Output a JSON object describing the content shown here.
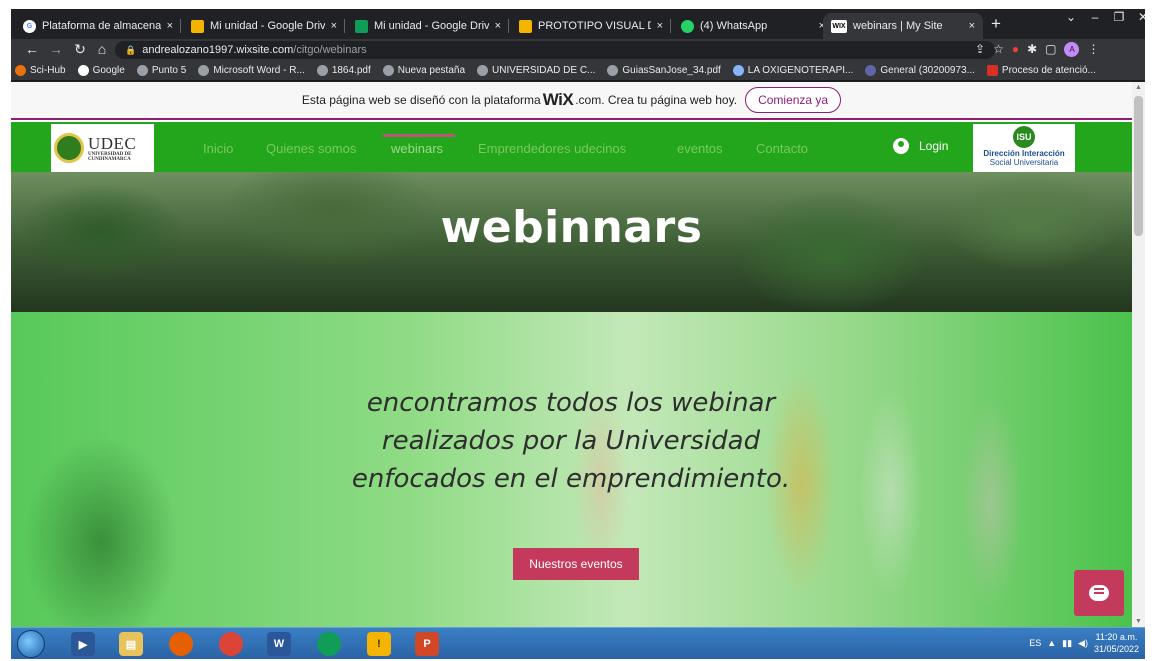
{
  "browser": {
    "tabs": [
      {
        "title": "Plataforma de almacenam",
        "icon": "google-icon",
        "active": false
      },
      {
        "title": "Mi unidad - Google Drive",
        "icon": "drive-icon",
        "active": false
      },
      {
        "title": "Mi unidad - Google Drive",
        "icon": "drive-icon",
        "active": false
      },
      {
        "title": "PROTOTIPO VISUAL DE LA",
        "icon": "drive-icon",
        "active": false
      },
      {
        "title": "(4) WhatsApp",
        "icon": "whatsapp-icon",
        "active": false
      },
      {
        "title": "webinars | My Site",
        "icon": "wix-icon",
        "active": true
      }
    ],
    "tab_close": "×",
    "new_tab": "+",
    "url_host": "andrealozano1997.wixsite.com",
    "url_path": "/citgo/webinars",
    "avatar_letter": "A",
    "bookmarks": [
      "Sci-Hub",
      "Google",
      "Punto 5",
      "Microsoft Word - R...",
      "1864.pdf",
      "Nueva pestaña",
      "UNIVERSIDAD DE C...",
      "GuiasSanJose_34.pdf",
      "LA OXIGENOTERAPI...",
      "General (30200973...",
      "Proceso de atenció..."
    ]
  },
  "wix_banner": {
    "prefix": "Esta página web se diseñó con la plataforma",
    "brand": "WiX",
    "suffix": ".com. Crea tu página web hoy.",
    "cta": "Comienza ya"
  },
  "site": {
    "logo_left": {
      "name": "UDEC",
      "sub": "UNIVERSIDAD DE CUNDINAMARCA"
    },
    "menu": [
      "Inicio",
      "Quienes somos",
      "webinars",
      "Emprendedores udecinos",
      "eventos",
      "Contacto"
    ],
    "active_menu": "webinars",
    "login": "Login",
    "logo_right": {
      "badge": "ISU",
      "line1": "Dirección Interacción",
      "line2": "Social Universitaria"
    }
  },
  "hero": {
    "title": "webinnars"
  },
  "section": {
    "lines": [
      "encontramos todos los webinar",
      "realizados por la Universidad",
      "enfocados en el emprendimiento."
    ],
    "button": "Nuestros eventos"
  },
  "taskbar": {
    "lang": "ES",
    "time": "11:20 a.m.",
    "date": "31/05/2022"
  },
  "colors": {
    "nav_green": "#24a61c",
    "accent_pink": "#c43a5c",
    "wix_purple": "#8e1e74"
  }
}
